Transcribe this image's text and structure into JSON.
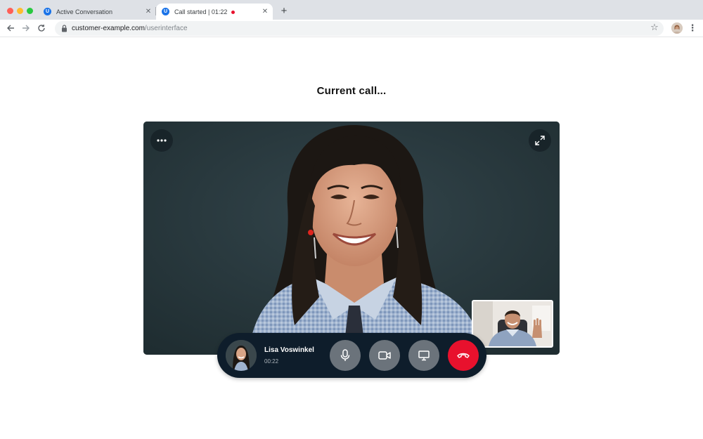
{
  "browser": {
    "tabs": [
      {
        "title": "Active Conversation",
        "favicon": "u-logo-icon",
        "active": false
      },
      {
        "title": "Call started | 01:22",
        "favicon": "u-logo-icon",
        "active": true,
        "recording_indicator_color": "#e8112d"
      }
    ],
    "favicon_letter": "U",
    "address_bar": {
      "host": "customer-example.com",
      "path": "/userinterface"
    }
  },
  "page": {
    "title": "Current call..."
  },
  "call": {
    "caller_name": "Lisa Voswinkel",
    "call_timer": "00:22",
    "controls": [
      "microphone-icon",
      "camera-icon",
      "screen-share-icon",
      "hang-up-icon"
    ]
  },
  "colors": {
    "hangup": "#e8112d",
    "control_bg": "#6b737b",
    "call_bar_bg": "#0e1d2b",
    "video_bg": "#26353a"
  }
}
